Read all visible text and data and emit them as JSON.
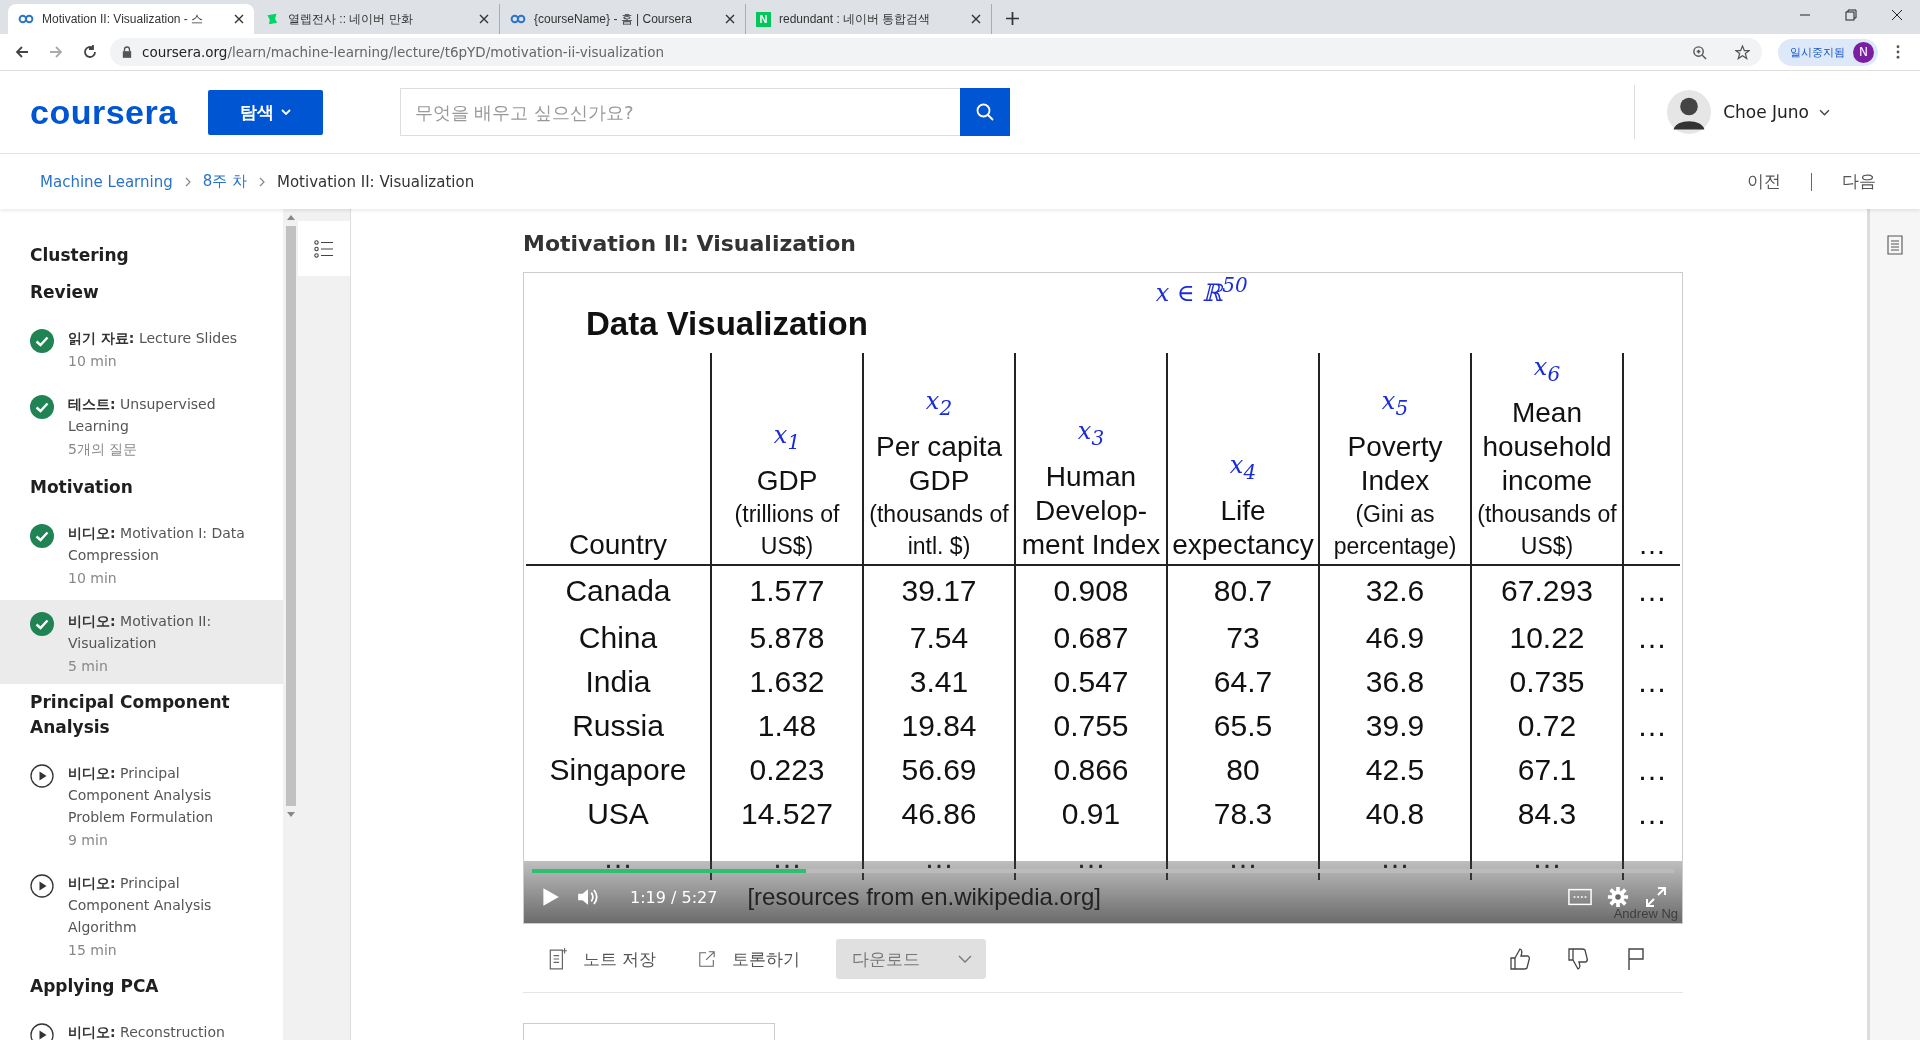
{
  "browser": {
    "tabs": [
      {
        "title": "Motivation II: Visualization - 스",
        "selected": true,
        "kind": "coursera"
      },
      {
        "title": "열렙전사 :: 네이버 만화",
        "selected": false,
        "kind": "webtoon"
      },
      {
        "title": "{courseName} - 홈 | Coursera",
        "selected": false,
        "kind": "coursera"
      },
      {
        "title": "redundant : 네이버 통합검색",
        "selected": false,
        "kind": "naver",
        "icon_text": "N"
      }
    ],
    "url_host": "coursera.org",
    "url_path": "/learn/machine-learning/lecture/t6pYD/motivation-ii-visualization",
    "profile": {
      "status": "일시중지됨",
      "initial": "N"
    }
  },
  "header": {
    "logo": "coursera",
    "explore": "탐색",
    "search_placeholder": "무엇을 배우고 싶으신가요?",
    "user": "Choe Juno"
  },
  "breadcrumb": {
    "items": [
      "Machine Learning",
      "8주 차",
      "Motivation II: Visualization"
    ],
    "prev": "이전",
    "next": "다음"
  },
  "sidebar": {
    "sections": [
      {
        "title": "Clustering"
      },
      {
        "title": "Review",
        "items": [
          {
            "type_label": "읽기 자료:",
            "title": "Lecture Slides",
            "meta": "10 min",
            "completed": true,
            "selected": false
          },
          {
            "type_label": "테스트:",
            "title": "Unsupervised Learning",
            "meta": "5개의 질문",
            "completed": true,
            "selected": false
          }
        ]
      },
      {
        "title": "Motivation",
        "items": [
          {
            "type_label": "비디오:",
            "title": "Motivation I: Data Compression",
            "meta": "10 min",
            "completed": true,
            "selected": false
          },
          {
            "type_label": "비디오:",
            "title": "Motivation II: Visualization",
            "meta": "5 min",
            "completed": true,
            "selected": true
          }
        ]
      },
      {
        "title": "Principal Component Analysis",
        "items": [
          {
            "type_label": "비디오:",
            "title": "Principal Component Analysis Problem Formulation",
            "meta": "9 min",
            "completed": false,
            "selected": false
          },
          {
            "type_label": "비디오:",
            "title": "Principal Component Analysis Algorithm",
            "meta": "15 min",
            "completed": false,
            "selected": false
          }
        ]
      },
      {
        "title": "Applying PCA",
        "items": [
          {
            "type_label": "비디오:",
            "title": "Reconstruction",
            "completed": false,
            "selected": false
          }
        ]
      }
    ]
  },
  "main": {
    "title": "Motivation II: Visualization"
  },
  "video": {
    "slide": {
      "title": "Data Visualization",
      "annotation": "x ∈ ℝ$^{50}$",
      "columns": [
        {
          "label": "Country"
        },
        {
          "mark": "x$_{1}$",
          "label": "GDP",
          "sub": "(trillions of US$)"
        },
        {
          "mark": "x$_{2}$",
          "label": "Per capita GDP",
          "sub": "(thousands of intl. $)"
        },
        {
          "mark": "x$_{3}$",
          "label": "Human Develop-ment Index"
        },
        {
          "mark": "x$_{4}$",
          "label": "Life expectancy"
        },
        {
          "mark": "x$_{5}$",
          "label": "Poverty Index",
          "sub": "(Gini as percentage)"
        },
        {
          "mark": "x$_{6}$",
          "label": "Mean household income",
          "sub": "(thousands of US$)"
        },
        {
          "label": "…"
        }
      ],
      "rows": [
        [
          "Canada",
          "1.577",
          "39.17",
          "0.908",
          "80.7",
          "32.6",
          "67.293",
          "…"
        ],
        [
          "China",
          "5.878",
          "7.54",
          "0.687",
          "73",
          "46.9",
          "10.22",
          "…"
        ],
        [
          "India",
          "1.632",
          "3.41",
          "0.547",
          "64.7",
          "36.8",
          "0.735",
          "…"
        ],
        [
          "Russia",
          "1.48",
          "19.84",
          "0.755",
          "65.5",
          "39.9",
          "0.72",
          "…"
        ],
        [
          "Singapore",
          "0.223",
          "56.69",
          "0.866",
          "80",
          "42.5",
          "67.1",
          "…"
        ],
        [
          "USA",
          "14.527",
          "46.86",
          "0.91",
          "78.3",
          "40.8",
          "84.3",
          "…"
        ],
        [
          "…",
          "…",
          "…",
          "…",
          "…",
          "…",
          "…",
          ""
        ]
      ],
      "source": "[resources from en.wikipedia.org]",
      "author": "Andrew Ng"
    },
    "controls": {
      "current": "1:19",
      "separator": "/",
      "duration": "5:27",
      "progress": {
        "level": 0.24
      }
    }
  },
  "actions": {
    "save_note": "노트 저장",
    "discuss": "토론하기",
    "download": "다운로드"
  }
}
